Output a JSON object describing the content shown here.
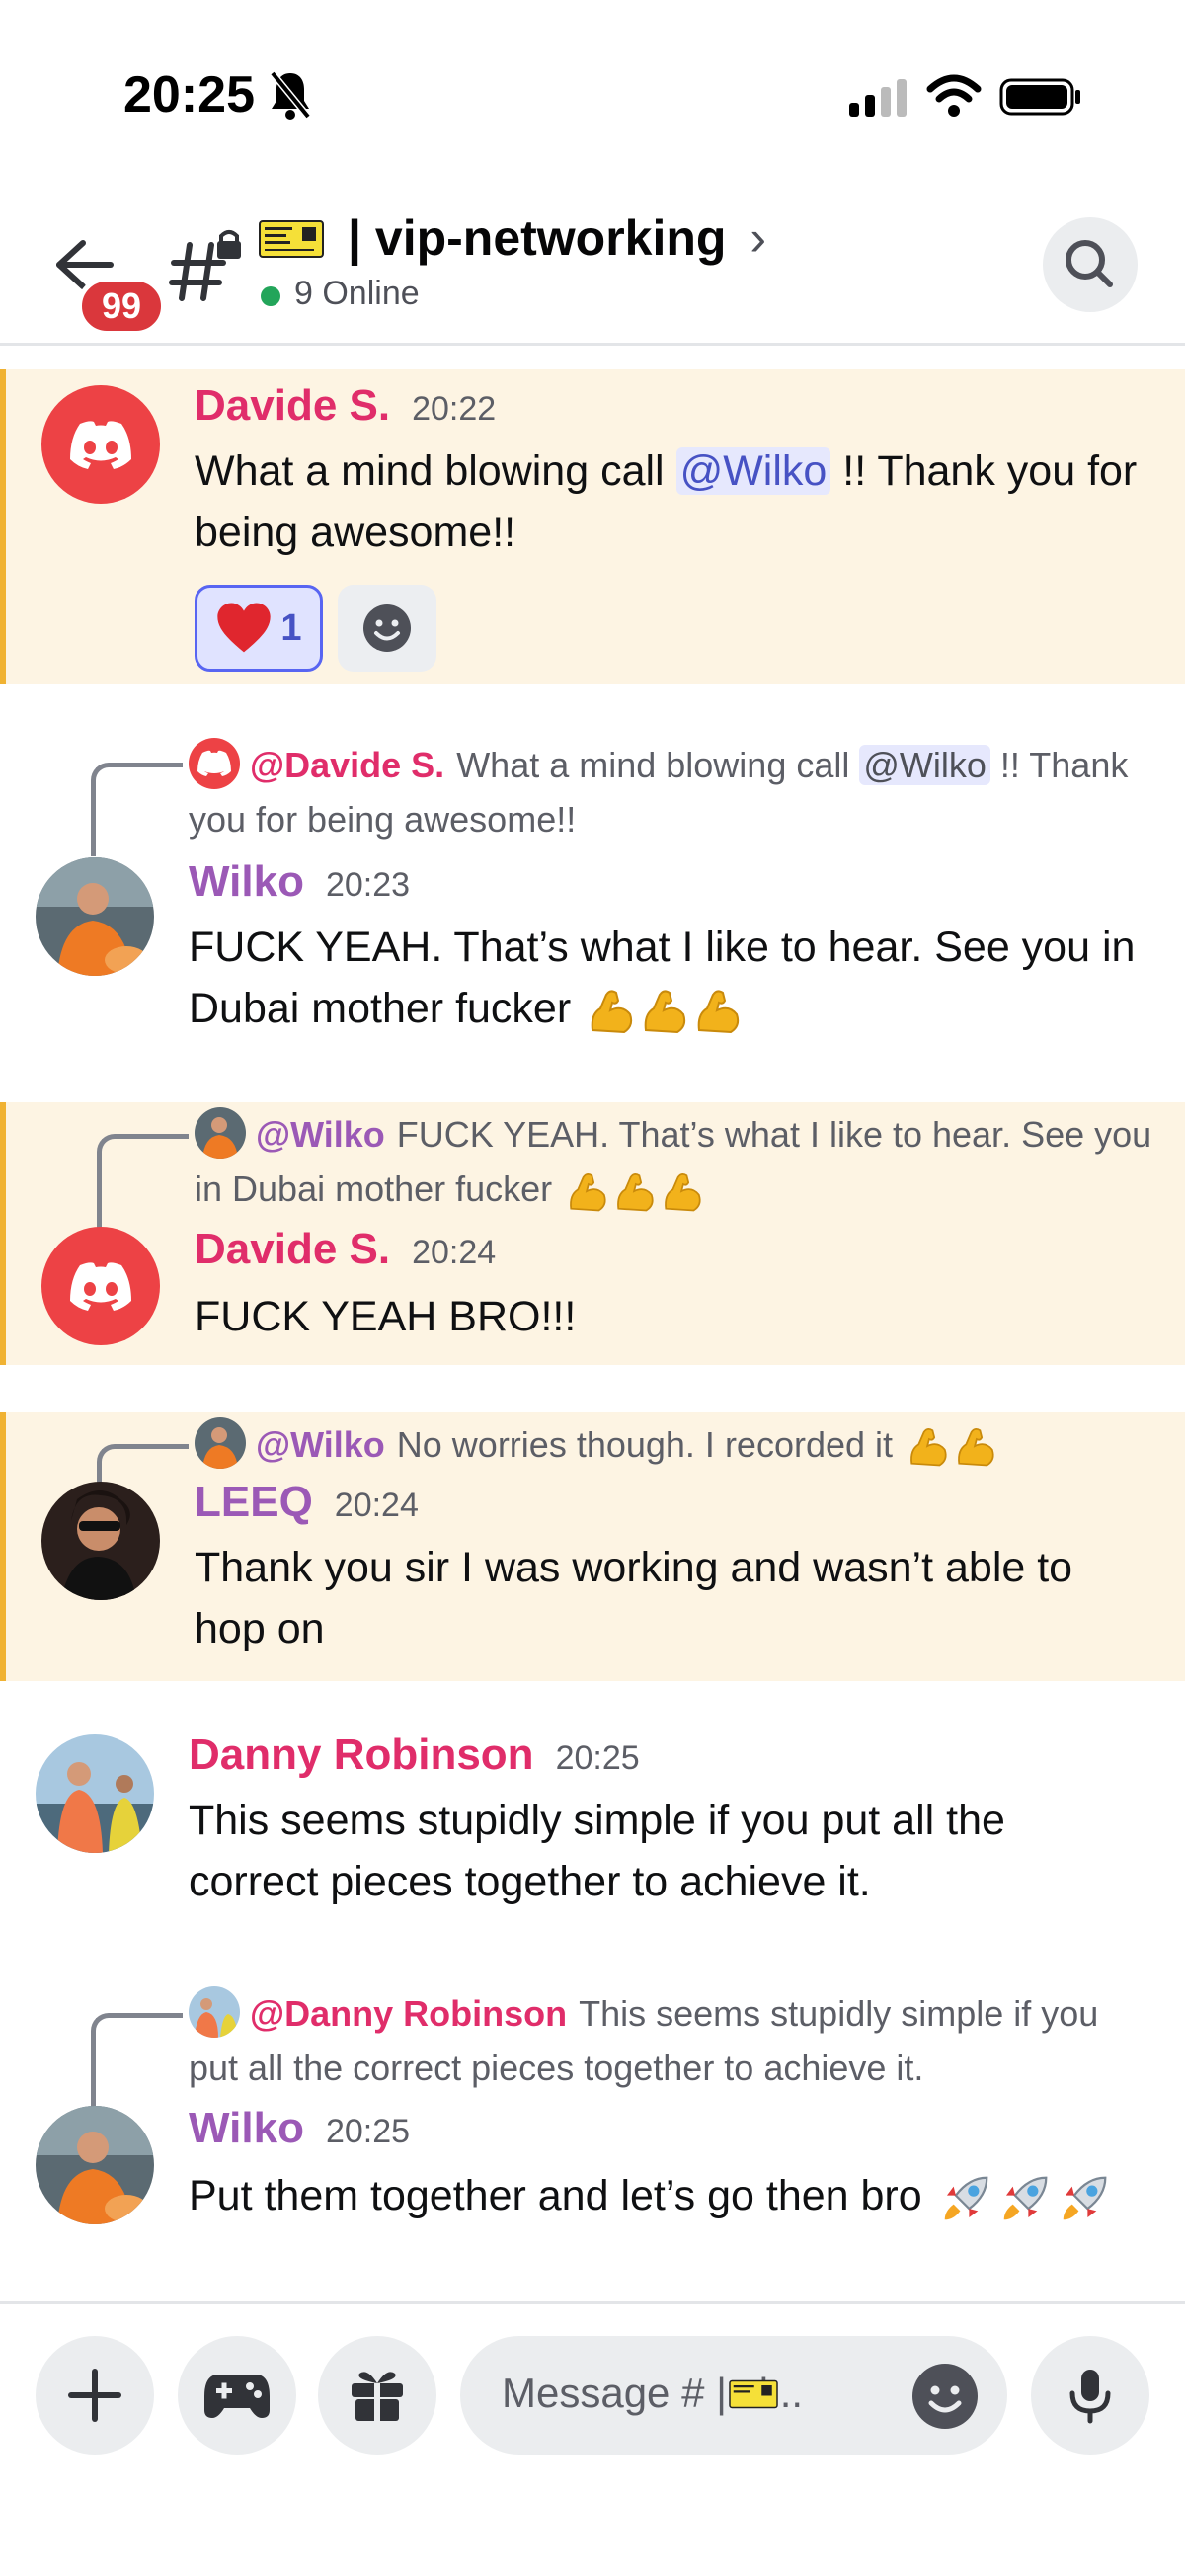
{
  "status_bar": {
    "time": "20:25"
  },
  "header": {
    "badge_count": "99",
    "channel_name": "| vip-networking",
    "chevron": "›",
    "online": "9 Online"
  },
  "messages": [
    {
      "author": "Davide S.",
      "time": "20:22",
      "text_pre": "What a mind blowing call ",
      "mention": "@Wilko",
      "text_post": " !! Thank you for being awesome!!",
      "reaction_count": "1"
    },
    {
      "reply_name": "@Davide S.",
      "reply_pre": "What a mind blowing call ",
      "reply_mention": "@Wilko",
      "reply_post": " !! Thank you for being awesome!!",
      "author": "Wilko",
      "time": "20:23",
      "text": "FUCK YEAH. That’s what I like to hear. See you in Dubai mother fucker"
    },
    {
      "reply_name": "@Wilko",
      "reply_text": "FUCK YEAH. That’s what I like to hear. See you in Dubai mother fucker",
      "author": "Davide S.",
      "time": "20:24",
      "text": "FUCK YEAH BRO!!!"
    },
    {
      "reply_name": "@Wilko",
      "reply_text": "No worries though. I recorded it",
      "author": "LEEQ",
      "time": "20:24",
      "text": "Thank you sir I was working and wasn’t able to hop on"
    },
    {
      "author": "Danny Robinson",
      "time": "20:25",
      "text": "This seems stupidly simple if you put all the correct pieces together to achieve it."
    },
    {
      "reply_name": "@Danny Robinson",
      "reply_text": "This seems stupidly simple if you put all the correct pieces together to achieve it.",
      "author": "Wilko",
      "time": "20:25",
      "text": "Put them together and let’s go then bro"
    }
  ],
  "composer": {
    "placeholder": "Message #     | vi..."
  },
  "colors": {
    "accent": "#5865f2",
    "davide": "#e02d6a",
    "wilko": "#9b59b6",
    "danny": "#e02d6a",
    "highlight_bg": "#fdf4e3",
    "highlight_bar": "#f0b232"
  },
  "icons": [
    "bell-slash-icon",
    "signal-icon",
    "wifi-icon",
    "battery-icon",
    "back-arrow-icon",
    "hash-lock-icon",
    "ticket-icon",
    "search-icon",
    "discord-icon",
    "heart-emoji-icon",
    "add-reaction-icon",
    "flexed-biceps-emoji-icon",
    "rocket-emoji-icon",
    "plus-icon",
    "gamepad-icon",
    "gift-icon",
    "emoji-icon",
    "microphone-icon"
  ]
}
